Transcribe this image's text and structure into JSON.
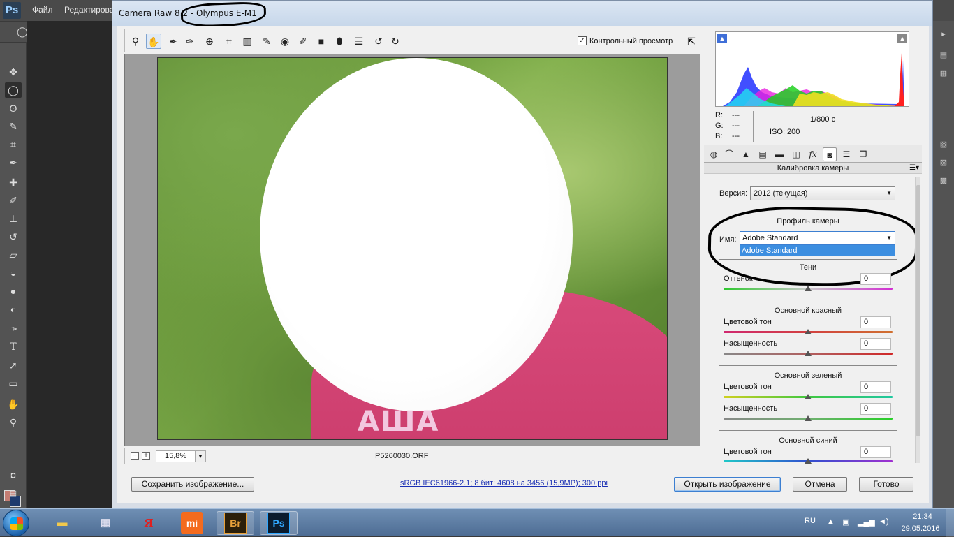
{
  "photoshop": {
    "logo": "Ps",
    "menu": [
      "Файл",
      "Редактирова"
    ]
  },
  "dialog": {
    "title": "Camera Raw 8.2  -  Olympus E-M1",
    "preview_checkbox_label": "Контрольный просмотр",
    "preview_checked": true,
    "zoom": "15,8%",
    "filename": "P5260030.ORF",
    "photo_overlay_text": "АША"
  },
  "histogram_info": {
    "r_label": "R:",
    "r_value": "---",
    "g_label": "G:",
    "g_value": "---",
    "b_label": "B:",
    "b_value": "---",
    "shutter": "1/800 с",
    "iso": "ISO: 200"
  },
  "panel": {
    "title": "Калибровка камеры",
    "version_label": "Версия:",
    "version_value": "2012 (текущая)",
    "profile_section": "Профиль камеры",
    "name_label": "Имя:",
    "name_value": "Adobe Standard",
    "name_dropdown_option": "Adobe Standard",
    "shadows_section": "Тени",
    "shadows_tint_label": "Оттенок",
    "shadows_tint_value": "0",
    "red_section": "Основной красный",
    "red_hue_label": "Цветовой тон",
    "red_hue_value": "0",
    "red_sat_label": "Насыщенность",
    "red_sat_value": "0",
    "green_section": "Основной зеленый",
    "green_hue_label": "Цветовой тон",
    "green_hue_value": "0",
    "green_sat_label": "Насыщенность",
    "green_sat_value": "0",
    "blue_section": "Основной синий",
    "blue_hue_label": "Цветовой тон",
    "blue_hue_value": "0"
  },
  "footer": {
    "save_label": "Сохранить изображение...",
    "workflow_link": "sRGB IEC61966-2.1; 8 бит; 4608 на 3456 (15,9МР); 300 ppi",
    "open_label": "Открыть изображение",
    "cancel_label": "Отмена",
    "done_label": "Готово"
  },
  "taskbar": {
    "apps": [
      "Проводник",
      "Калькулятор",
      "Я",
      "mi",
      "Br",
      "Ps"
    ],
    "language": "RU",
    "time": "21:34",
    "date": "29.05.2016"
  },
  "colors": {
    "accent": "#3c8ee0",
    "ps_foreground": "#c57d73",
    "ps_background": "#1f3b6e"
  }
}
